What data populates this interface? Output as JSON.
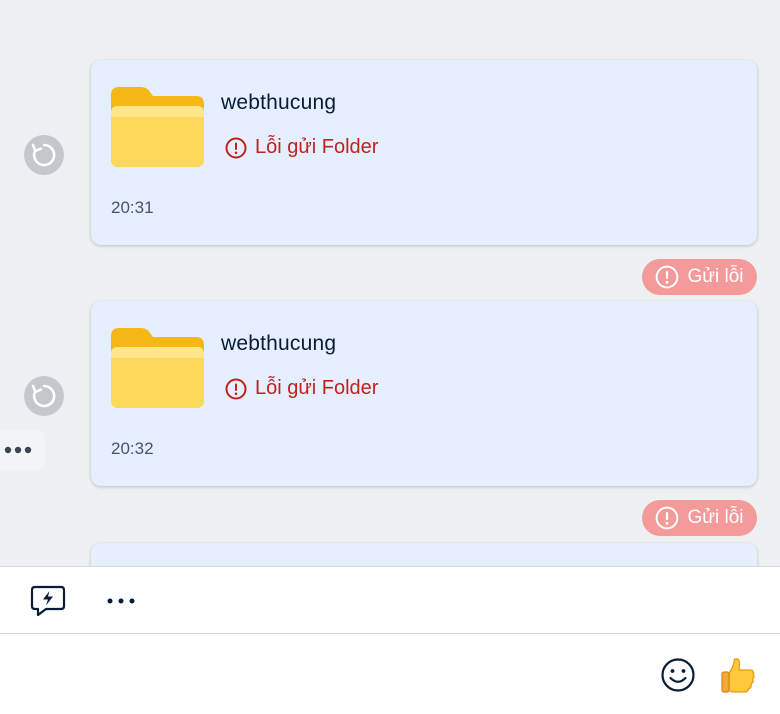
{
  "messages": [
    {
      "file_name": "webthucung",
      "error": "Lỗi gửi Folder",
      "time": "20:31",
      "status": "Gửi lỗi"
    },
    {
      "file_name": "webthucung",
      "error": "Lỗi gửi Folder",
      "time": "20:32",
      "status": "Gửi lỗi"
    }
  ],
  "composer": {
    "placeholder": ""
  },
  "colors": {
    "card_bg": "#e5efff",
    "error_red": "#c0231c",
    "badge_bg": "#f49a9a",
    "folder_yellow": "#fcd95a"
  },
  "icons": {
    "retry": "retry-icon",
    "folder": "folder-icon",
    "error": "error-circle-icon",
    "more": "more-dots-icon",
    "quick_message": "quick-message-icon",
    "emoji": "emoji-icon",
    "like": "thumbs-up-icon"
  }
}
